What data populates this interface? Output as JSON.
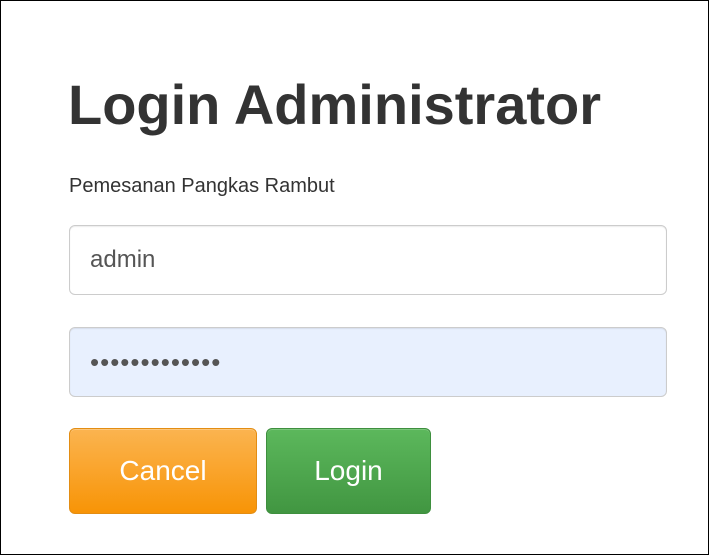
{
  "form": {
    "title": "Login Administrator",
    "subtitle": "Pemesanan Pangkas Rambut",
    "username_value": "admin",
    "password_value": "•••••••••••••",
    "cancel_label": "Cancel",
    "login_label": "Login"
  },
  "colors": {
    "cancel_button": "#f89406",
    "login_button": "#5cb85c",
    "password_autofill_bg": "#e8f0fe",
    "title_text": "#333333"
  }
}
